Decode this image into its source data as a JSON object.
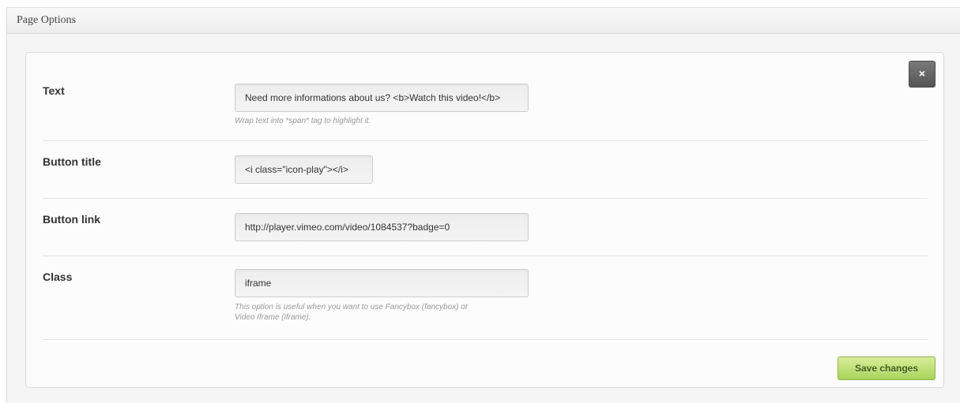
{
  "header": {
    "title": "Page Options"
  },
  "close_button": {
    "label": "×"
  },
  "fields": [
    {
      "label": "Text",
      "value": "Need more informations about us? <b>Watch this video!</b>",
      "help": "Wrap text into *span* tag to highlight it."
    },
    {
      "label": "Button title",
      "value": "<i class=\"icon-play\"></i>",
      "help": ""
    },
    {
      "label": "Button link",
      "value": "http://player.vimeo.com/video/1084537?badge=0",
      "help": ""
    },
    {
      "label": "Class",
      "value": "iframe",
      "help_line1": "This option is useful when you want to use Fancybox (fancybox) or",
      "help_line2": "Video Iframe (iframe)."
    }
  ],
  "save_button": {
    "label": "Save changes"
  }
}
